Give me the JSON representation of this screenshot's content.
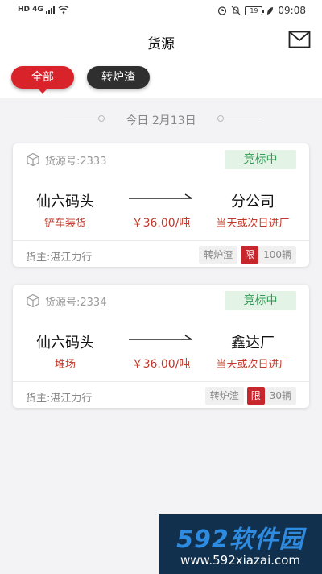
{
  "status_bar": {
    "network": "HD 4G",
    "battery": "19",
    "time": "09:08"
  },
  "nav": {
    "title": "货源"
  },
  "filters": [
    {
      "label": "全部",
      "active": true
    },
    {
      "label": "转炉渣",
      "active": false
    }
  ],
  "date_label": "今日 2月13日",
  "cards": [
    {
      "source_no": "货源号:2333",
      "status": "竞标中",
      "origin": "仙六码头",
      "origin_sub": "铲车装货",
      "price": "￥36.00/吨",
      "destination": "分公司",
      "destination_sub": "当天或次日进厂",
      "owner": "货主:湛江力行",
      "cargo_type": "转炉渣",
      "limit_label": "限",
      "vehicle_count": "100辆"
    },
    {
      "source_no": "货源号:2334",
      "status": "竞标中",
      "origin": "仙六码头",
      "origin_sub": "堆场",
      "price": "￥36.00/吨",
      "destination": "鑫达厂",
      "destination_sub": "当天或次日进厂",
      "owner": "货主:湛江力行",
      "cargo_type": "转炉渣",
      "limit_label": "限",
      "vehicle_count": "30辆"
    }
  ],
  "watermark": {
    "brand": "592软件园",
    "url": "www.592xiazai.com"
  },
  "colors": {
    "accent_red": "#d8232a",
    "dark_chip": "#2f2f2f",
    "status_green": "#2f9a53"
  }
}
